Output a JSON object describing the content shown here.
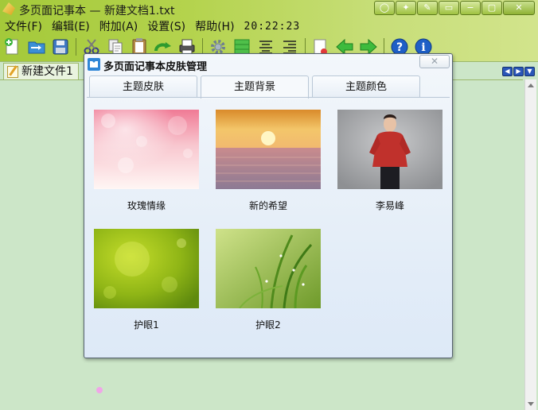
{
  "window": {
    "title": "多页面记事本 — 新建文档1.txt",
    "buttons": [
      "◯",
      "✦",
      "✎",
      "▭",
      "−",
      "▢",
      "✕"
    ]
  },
  "menu": {
    "items": [
      "文件(F)",
      "编辑(E)",
      "附加(A)",
      "设置(S)",
      "帮助(H)"
    ],
    "clock": "20:22:23"
  },
  "toolbar": {
    "icons": [
      "new-file",
      "open-folder",
      "save",
      "cut",
      "copy",
      "paste",
      "redo",
      "print",
      "settings",
      "green-grid",
      "align-center",
      "align-right",
      "document",
      "back-arrow",
      "forward-arrow",
      "help",
      "info"
    ]
  },
  "document": {
    "tab_label": "新建文件1",
    "tab_nav": [
      "◀",
      "▶",
      "▼"
    ]
  },
  "dialog": {
    "title": "多页面记事本皮肤管理",
    "close_label": "✕",
    "tabs": [
      "主题皮肤",
      "主题背景",
      "主题颜色"
    ],
    "active_tab": 1,
    "themes": [
      {
        "label": "玫瑰情缘",
        "image": "pink-bokeh"
      },
      {
        "label": "新的希望",
        "image": "sunset-sea"
      },
      {
        "label": "李易峰",
        "image": "man-red-shirt"
      },
      {
        "label": "护眼1",
        "image": "green-bokeh"
      },
      {
        "label": "护眼2",
        "image": "green-grass"
      }
    ]
  },
  "colors": {
    "toolbar_green": "#b4d34d",
    "document_bg": "#cce6c8",
    "dialog_bg": "#e5eef8"
  }
}
